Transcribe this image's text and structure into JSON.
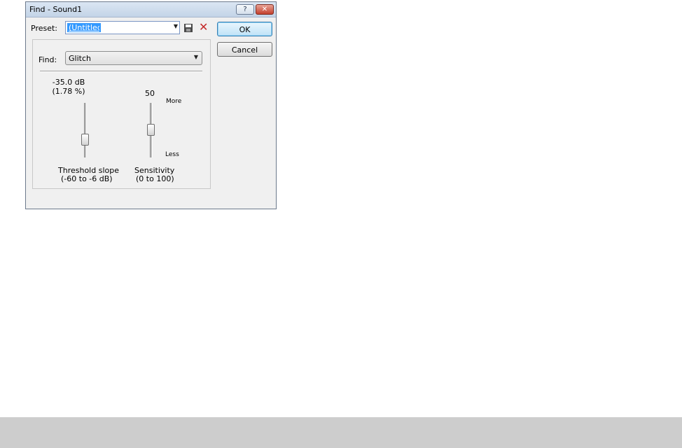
{
  "window": {
    "title": "Find - Sound1",
    "help_label": "?",
    "close_label": "✕"
  },
  "preset": {
    "label": "Preset:",
    "value": "(Untitled)"
  },
  "buttons": {
    "ok": "OK",
    "cancel": "Cancel"
  },
  "find": {
    "label": "Find:",
    "selected": "Glitch"
  },
  "threshold": {
    "value_db": "-35.0 dB",
    "value_pct": "(1.78 %)",
    "caption": "Threshold slope",
    "range": "(-60 to -6 dB)",
    "level_db": -35.0
  },
  "sensitivity": {
    "value": "50",
    "caption": "Sensitivity",
    "range": "(0 to 100)",
    "more_label": "More",
    "less_label": "Less",
    "level": 50
  },
  "icons": {
    "save": "save-icon",
    "delete": "delete-icon",
    "dropdown": "chevron-down-icon"
  },
  "colors": {
    "selection": "#3399ff",
    "delete": "#c42b2b",
    "close_button": "#c4402d"
  }
}
